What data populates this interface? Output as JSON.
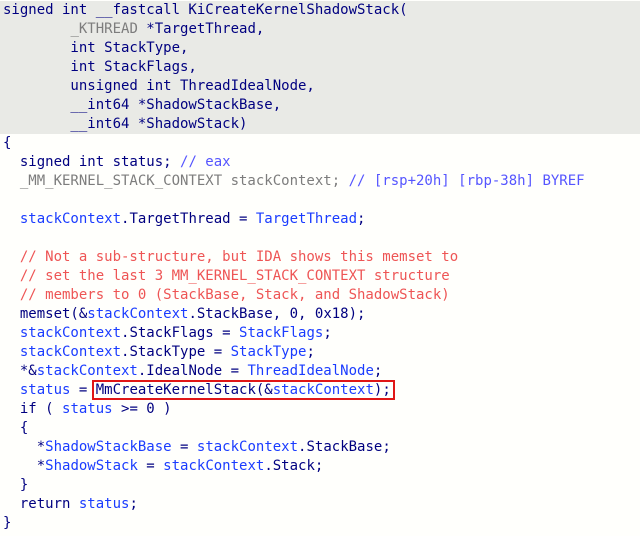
{
  "lines": [
    {
      "hl": true,
      "parts": [
        {
          "c": "kw",
          "t": "signed int __fastcall KiCreateKernelShadowStack("
        }
      ]
    },
    {
      "hl": true,
      "parts": [
        {
          "c": "punc",
          "t": "        "
        },
        {
          "c": "gray",
          "t": "_KTHREAD"
        },
        {
          "c": "punc",
          "t": " *TargetThread,"
        }
      ]
    },
    {
      "hl": true,
      "parts": [
        {
          "c": "punc",
          "t": "        int StackType,"
        }
      ]
    },
    {
      "hl": true,
      "parts": [
        {
          "c": "punc",
          "t": "        int StackFlags,"
        }
      ]
    },
    {
      "hl": true,
      "parts": [
        {
          "c": "punc",
          "t": "        unsigned int ThreadIdealNode,"
        }
      ]
    },
    {
      "hl": true,
      "parts": [
        {
          "c": "punc",
          "t": "        __int64 *ShadowStackBase,"
        }
      ]
    },
    {
      "hl": true,
      "parts": [
        {
          "c": "punc",
          "t": "        __int64 *ShadowStack)"
        }
      ]
    },
    {
      "hl": false,
      "parts": [
        {
          "c": "punc",
          "t": "{"
        }
      ]
    },
    {
      "hl": false,
      "parts": [
        {
          "c": "punc",
          "t": "  signed int status; "
        },
        {
          "c": "cmt",
          "t": "// eax"
        }
      ]
    },
    {
      "hl": false,
      "parts": [
        {
          "c": "gray",
          "t": "  _MM_KERNEL_STACK_CONTEXT stackContext; "
        },
        {
          "c": "cmt",
          "t": "// [rsp+20h] [rbp-38h] BYREF"
        }
      ]
    },
    {
      "hl": false,
      "parts": [
        {
          "c": "punc",
          "t": ""
        }
      ]
    },
    {
      "hl": false,
      "parts": [
        {
          "c": "blue",
          "t": "  stackContext"
        },
        {
          "c": "punc",
          "t": ".TargetThread = "
        },
        {
          "c": "blue",
          "t": "TargetThread"
        },
        {
          "c": "punc",
          "t": ";"
        }
      ]
    },
    {
      "hl": false,
      "parts": [
        {
          "c": "punc",
          "t": ""
        }
      ]
    },
    {
      "hl": false,
      "parts": [
        {
          "c": "cmt2",
          "t": "  // Not a sub-structure, but IDA shows this memset to"
        }
      ]
    },
    {
      "hl": false,
      "parts": [
        {
          "c": "cmt2",
          "t": "  // set the last 3 MM_KERNEL_STACK_CONTEXT structure"
        }
      ]
    },
    {
      "hl": false,
      "parts": [
        {
          "c": "cmt2",
          "t": "  // members to 0 (StackBase, Stack, and ShadowStack)"
        }
      ]
    },
    {
      "hl": false,
      "parts": [
        {
          "c": "punc",
          "t": "  memset(&"
        },
        {
          "c": "blue",
          "t": "stackContext"
        },
        {
          "c": "punc",
          "t": ".StackBase, 0, 0x18);"
        }
      ]
    },
    {
      "hl": false,
      "parts": [
        {
          "c": "blue",
          "t": "  stackContext"
        },
        {
          "c": "punc",
          "t": ".StackFlags = "
        },
        {
          "c": "blue",
          "t": "StackFlags"
        },
        {
          "c": "punc",
          "t": ";"
        }
      ]
    },
    {
      "hl": false,
      "parts": [
        {
          "c": "blue",
          "t": "  stackContext"
        },
        {
          "c": "punc",
          "t": ".StackType = "
        },
        {
          "c": "blue",
          "t": "StackType"
        },
        {
          "c": "punc",
          "t": ";"
        }
      ]
    },
    {
      "hl": false,
      "parts": [
        {
          "c": "punc",
          "t": "  *&"
        },
        {
          "c": "blue",
          "t": "stackContext"
        },
        {
          "c": "punc",
          "t": ".IdealNode = "
        },
        {
          "c": "blue",
          "t": "ThreadIdealNode"
        },
        {
          "c": "punc",
          "t": ";"
        }
      ]
    },
    {
      "hl": false,
      "box": true,
      "parts": [
        {
          "c": "blue",
          "t": "  status"
        },
        {
          "c": "punc",
          "t": " = "
        }
      ],
      "boxparts": [
        {
          "c": "punc",
          "t": "MmCreateKernelStack(&"
        },
        {
          "c": "blue",
          "t": "stackContext"
        },
        {
          "c": "punc",
          "t": ");"
        }
      ]
    },
    {
      "hl": false,
      "parts": [
        {
          "c": "punc",
          "t": "  if ( "
        },
        {
          "c": "blue",
          "t": "status"
        },
        {
          "c": "punc",
          "t": " >= 0 )"
        }
      ]
    },
    {
      "hl": false,
      "parts": [
        {
          "c": "punc",
          "t": "  {"
        }
      ]
    },
    {
      "hl": false,
      "parts": [
        {
          "c": "punc",
          "t": "    *"
        },
        {
          "c": "blue",
          "t": "ShadowStackBase"
        },
        {
          "c": "punc",
          "t": " = "
        },
        {
          "c": "blue",
          "t": "stackContext"
        },
        {
          "c": "punc",
          "t": ".StackBase;"
        }
      ]
    },
    {
      "hl": false,
      "parts": [
        {
          "c": "punc",
          "t": "    *"
        },
        {
          "c": "blue",
          "t": "ShadowStack"
        },
        {
          "c": "punc",
          "t": " = "
        },
        {
          "c": "blue",
          "t": "stackContext"
        },
        {
          "c": "punc",
          "t": ".Stack;"
        }
      ]
    },
    {
      "hl": false,
      "parts": [
        {
          "c": "punc",
          "t": "  }"
        }
      ]
    },
    {
      "hl": false,
      "parts": [
        {
          "c": "punc",
          "t": "  return "
        },
        {
          "c": "blue",
          "t": "status"
        },
        {
          "c": "punc",
          "t": ";"
        }
      ]
    },
    {
      "hl": false,
      "parts": [
        {
          "c": "punc",
          "t": "}"
        }
      ]
    }
  ],
  "colors": {
    "background": "#fffffc",
    "highlight": "#e9eae6",
    "default_text": "#000080",
    "identifier": "#1a3cff",
    "type_gray": "#7d7d7d",
    "comment_blue": "#5555ff",
    "comment_red": "#ee5555",
    "box_outline": "#e01616"
  }
}
